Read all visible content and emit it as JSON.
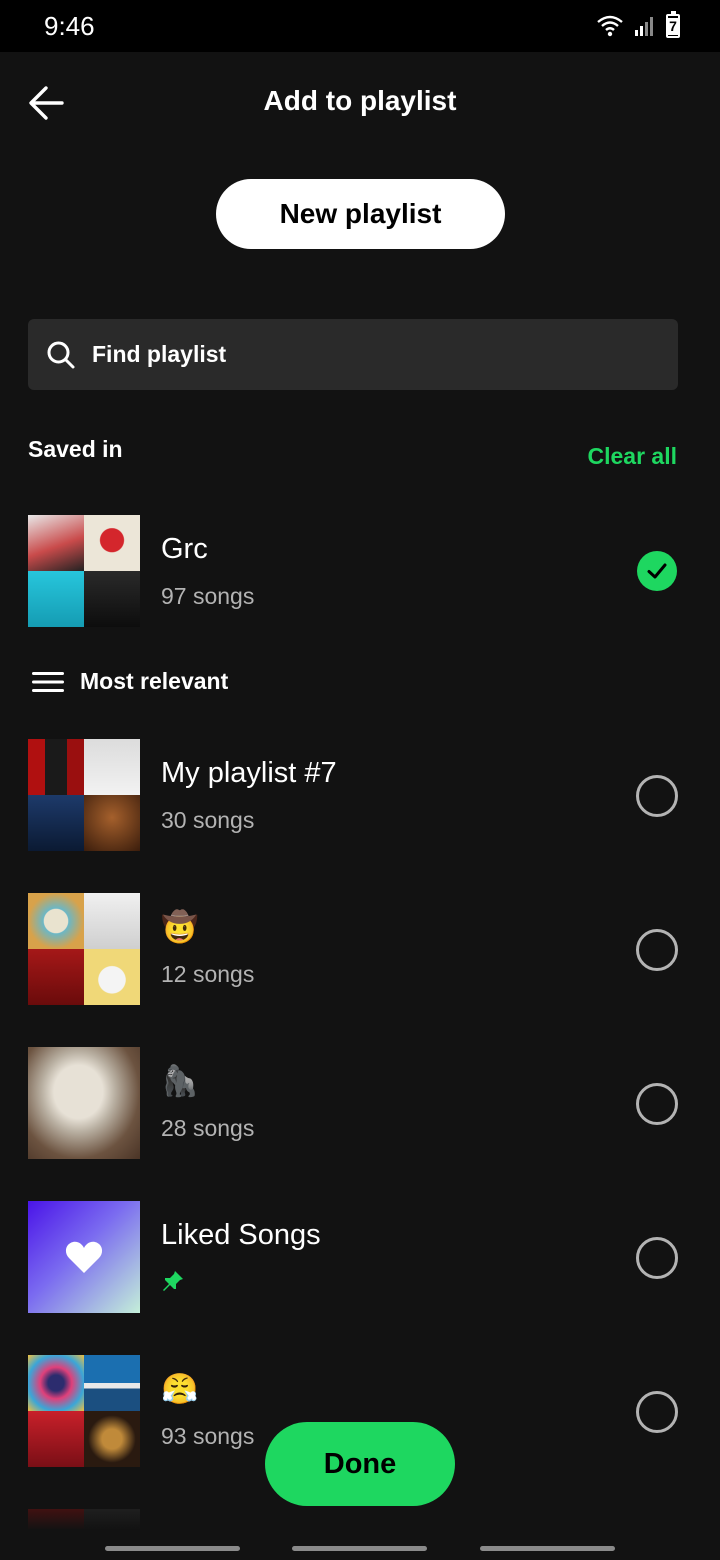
{
  "status": {
    "time": "9:46",
    "battery": "7"
  },
  "header": {
    "title": "Add to playlist"
  },
  "new_playlist_label": "New playlist",
  "search": {
    "placeholder": "Find playlist"
  },
  "saved_section": {
    "label": "Saved in",
    "clear_label": "Clear all"
  },
  "saved_playlists": [
    {
      "title": "Grc",
      "subtitle": "97 songs",
      "selected": true
    }
  ],
  "sort_label": "Most relevant",
  "playlists": [
    {
      "title": "My playlist #7",
      "subtitle": "30 songs",
      "selected": false
    },
    {
      "title": "🤠",
      "subtitle": "12 songs",
      "selected": false
    },
    {
      "title": "🦍",
      "subtitle": "28 songs",
      "selected": false
    },
    {
      "title": "Liked Songs",
      "subtitle": "",
      "pinned": true,
      "selected": false
    },
    {
      "title": "😤",
      "subtitle": "93 songs",
      "selected": false
    }
  ],
  "done_label": "Done",
  "colors": {
    "accent": "#1ed760",
    "background": "#121212",
    "surface": "#2a2a2a",
    "muted": "#b3b3b3"
  }
}
